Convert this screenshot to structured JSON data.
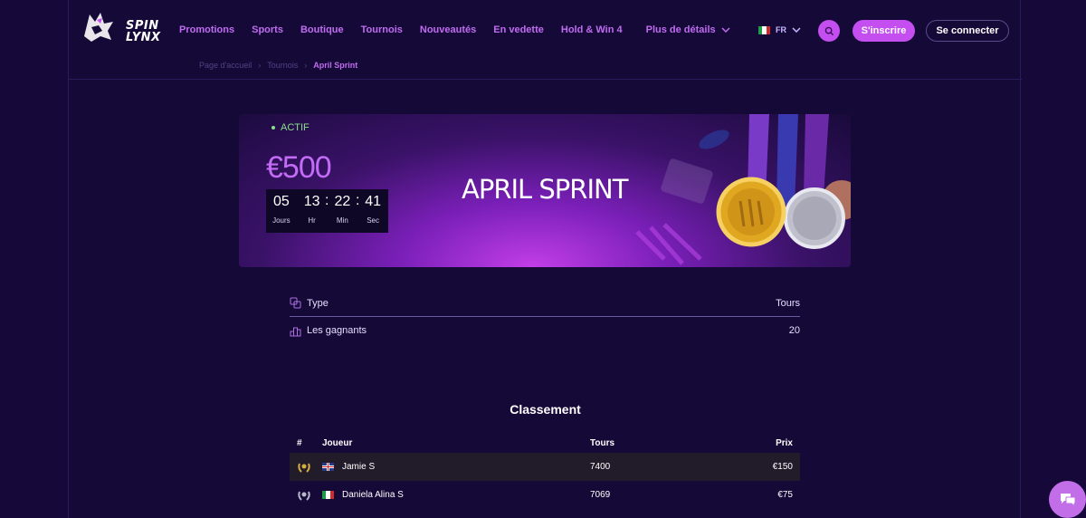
{
  "header": {
    "logo_line1": "SPIN",
    "logo_line2": "LYNX",
    "nav": [
      {
        "label": "Promotions"
      },
      {
        "label": "Sports"
      },
      {
        "label": "Boutique"
      },
      {
        "label": "Tournois"
      },
      {
        "label": "Nouveautés"
      },
      {
        "label": "En vedette"
      },
      {
        "label": "Hold & Win 4"
      }
    ],
    "more_label": "Plus de détails",
    "language": "FR",
    "signup_label": "S'inscrire",
    "login_label": "Se connecter"
  },
  "breadcrumb": {
    "home": "Page d'accueil",
    "sep": "›",
    "section": "Tournois",
    "current": "April Sprint"
  },
  "banner": {
    "status": "ACTIF",
    "prize": "€500",
    "title": "APRIL SPRINT",
    "countdown": {
      "days": "05",
      "days_label": "Jours",
      "hours": "13",
      "hours_label": "Hr",
      "minutes": "22",
      "minutes_label": "Min",
      "seconds": "41",
      "seconds_label": "Sec",
      "separator": ":"
    }
  },
  "info": {
    "type_label": "Type",
    "type_value": "Tours",
    "winners_label": "Les gagnants",
    "winners_value": "20"
  },
  "leaderboard": {
    "title": "Classement",
    "headers": {
      "rank": "#",
      "player": "Joueur",
      "tours": "Tours",
      "prize": "Prix"
    },
    "rows": [
      {
        "player": "Jamie S",
        "tours": "7400",
        "prize": "€150",
        "flag": "uk",
        "rank_icon": "gold-laurel-icon"
      },
      {
        "player": "Daniela Alina S",
        "tours": "7069",
        "prize": "€75",
        "flag": "it",
        "rank_icon": "silver-laurel-icon"
      }
    ]
  },
  "colors": {
    "background": "#150938",
    "accent": "#c44ef0",
    "nav_text": "#c06cf0",
    "active_status": "#8ae08a"
  },
  "icons": {
    "search": "search-icon",
    "chevron": "chevron-down-icon",
    "type": "dice-icon",
    "winners": "podium-icon",
    "chat": "chat-icon"
  }
}
